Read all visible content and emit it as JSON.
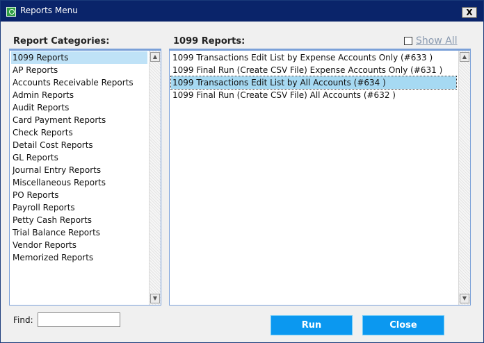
{
  "window": {
    "title": "Reports Menu",
    "close_label": "X"
  },
  "categories": {
    "label": "Report Categories:",
    "items": [
      "1099 Reports",
      "AP Reports",
      "Accounts Receivable Reports",
      "Admin Reports",
      "Audit Reports",
      "Card Payment Reports",
      "Check Reports",
      "Detail Cost Reports",
      "GL Reports",
      "Journal Entry Reports",
      "Miscellaneous Reports",
      "PO Reports",
      "Payroll Reports",
      "Petty Cash Reports",
      "Trial Balance Reports",
      "Vendor Reports",
      "Memorized Reports"
    ],
    "selected_index": 0
  },
  "reports": {
    "label": "1099 Reports:",
    "items": [
      "1099 Transactions Edit List by Expense Accounts Only (#633 )",
      "1099 Final Run (Create CSV File) Expense Accounts Only (#631 )",
      "1099 Transactions Edit List by All Accounts (#634 )",
      "1099 Final Run (Create CSV File) All Accounts (#632 )"
    ],
    "selected_index": 2
  },
  "show_all": {
    "label": "Show All",
    "checked": false
  },
  "find": {
    "label": "Find:",
    "value": ""
  },
  "buttons": {
    "run": "Run",
    "close": "Close"
  },
  "colors": {
    "titlebar": "#0a246a",
    "button": "#0b98f0",
    "selection": "#bfe2f7",
    "list_border": "#7aa0d8"
  }
}
